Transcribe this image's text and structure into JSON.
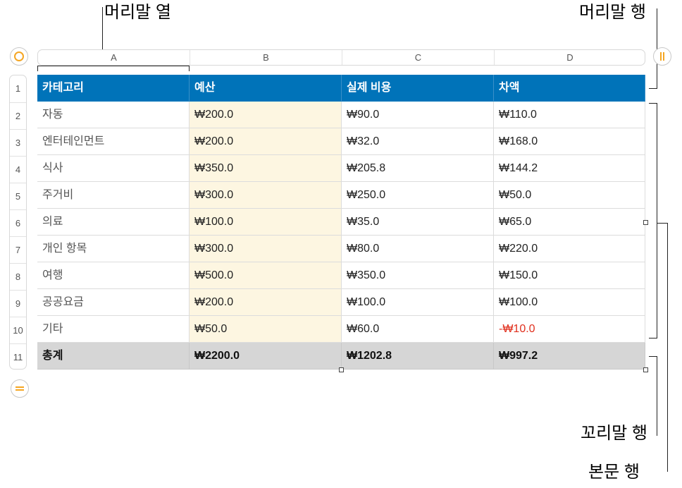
{
  "callouts": {
    "header_column": "머리말 열",
    "header_row": "머리말 행",
    "footer_row": "꼬리말 행",
    "body_rows": "본문 행"
  },
  "column_letters": [
    "A",
    "B",
    "C",
    "D"
  ],
  "row_numbers": [
    "1",
    "2",
    "3",
    "4",
    "5",
    "6",
    "7",
    "8",
    "9",
    "10",
    "11"
  ],
  "table": {
    "header": [
      "카테고리",
      "예산",
      "실제 비용",
      "차액"
    ],
    "rows": [
      [
        "자동",
        "₩200.0",
        "₩90.0",
        "₩110.0"
      ],
      [
        "엔터테인먼트",
        "₩200.0",
        "₩32.0",
        "₩168.0"
      ],
      [
        "식사",
        "₩350.0",
        "₩205.8",
        "₩144.2"
      ],
      [
        "주거비",
        "₩300.0",
        "₩250.0",
        "₩50.0"
      ],
      [
        "의료",
        "₩100.0",
        "₩35.0",
        "₩65.0"
      ],
      [
        "개인 항목",
        "₩300.0",
        "₩80.0",
        "₩220.0"
      ],
      [
        "여행",
        "₩500.0",
        "₩350.0",
        "₩150.0"
      ],
      [
        "공공요금",
        "₩200.0",
        "₩100.0",
        "₩100.0"
      ],
      [
        "기타",
        "₩50.0",
        "₩60.0",
        "-₩10.0"
      ]
    ],
    "footer": [
      "총계",
      "₩2200.0",
      "₩1202.8",
      "₩997.2"
    ]
  },
  "colors": {
    "header_bg": "#0073b9",
    "budget_column_bg": "#fdf6e1",
    "footer_bg": "#d6d6d6",
    "negative_text": "#e0301e",
    "control_accent": "#f5a623"
  },
  "icons": {
    "select_table": "select-table-icon",
    "add_column": "add-column-icon",
    "add_row": "add-row-icon"
  }
}
